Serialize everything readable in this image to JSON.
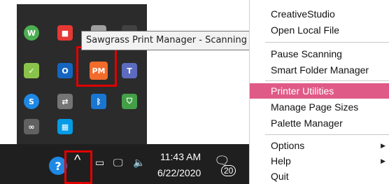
{
  "tooltip": {
    "text": "Sawgrass Print Manager - Scanning"
  },
  "tray_icons": [
    {
      "name": "wacom-icon",
      "glyph": "W",
      "color": "#4caf50"
    },
    {
      "name": "app-colorful-icon",
      "glyph": "■",
      "color": "#e53935"
    },
    {
      "name": "window-icon",
      "glyph": "▭",
      "color": "#9e9e9e"
    },
    {
      "name": "display-icon",
      "glyph": "▯",
      "color": "#424242"
    },
    {
      "name": "shield-check-icon",
      "glyph": "✓",
      "color": "#8bc34a"
    },
    {
      "name": "outlook-icon",
      "glyph": "O",
      "color": "#1565c0"
    },
    {
      "name": "print-manager-icon",
      "glyph": "PM",
      "color": "#f26b2a"
    },
    {
      "name": "teams-icon",
      "glyph": "T",
      "color": "#5c6bc0"
    },
    {
      "name": "skype-icon",
      "glyph": "S",
      "color": "#1e88e5"
    },
    {
      "name": "network-adapter-icon",
      "glyph": "⇄",
      "color": "#757575"
    },
    {
      "name": "bluetooth-icon",
      "glyph": "ᛒ",
      "color": "#1976d2"
    },
    {
      "name": "security-shield-icon",
      "glyph": "⛉",
      "color": "#43a047"
    },
    {
      "name": "link-icon",
      "glyph": "∞",
      "color": "#616161"
    },
    {
      "name": "grid-app-icon",
      "glyph": "▦",
      "color": "#039be5"
    }
  ],
  "taskbar": {
    "time": "11:43 AM",
    "date": "6/22/2020",
    "notification_count": "20"
  },
  "menu": {
    "items": [
      {
        "label": "CreativeStudio"
      },
      {
        "label": "Open Local File"
      },
      {
        "label": "Pause Scanning"
      },
      {
        "label": "Smart Folder Manager"
      },
      {
        "label": "Printer Utilities"
      },
      {
        "label": "Manage Page Sizes"
      },
      {
        "label": "Palette Manager"
      },
      {
        "label": "Options"
      },
      {
        "label": "Help"
      },
      {
        "label": "Quit"
      }
    ],
    "active_color": "#e05a87"
  }
}
